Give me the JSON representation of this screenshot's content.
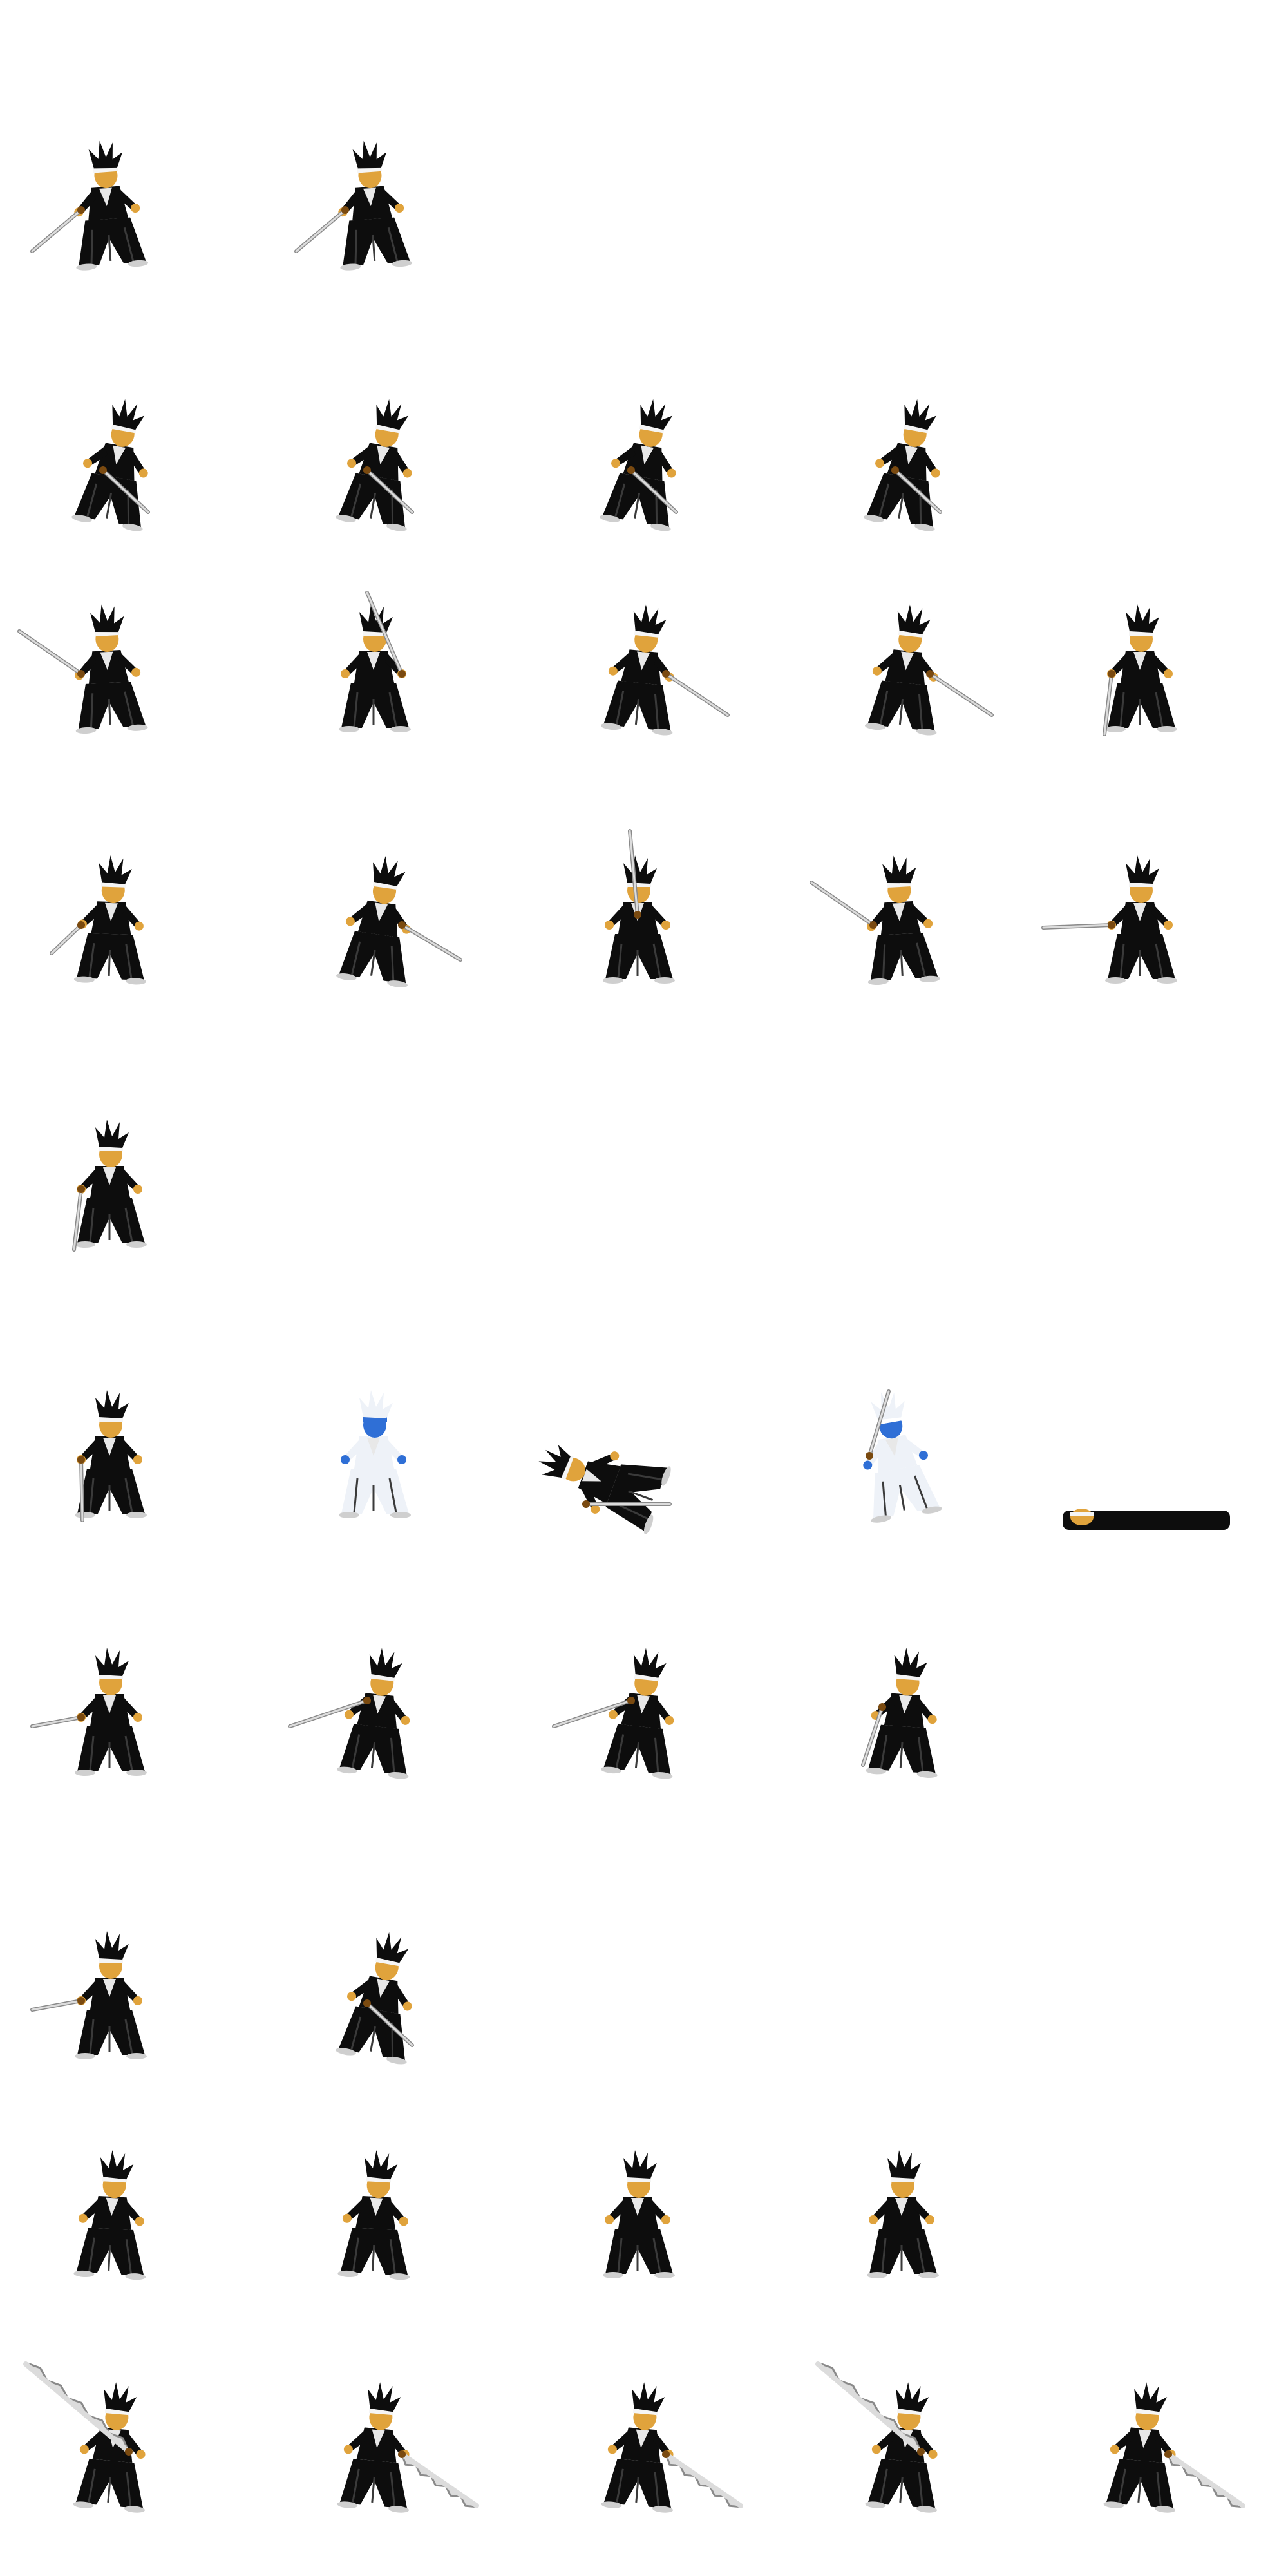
{
  "sheet": {
    "background": "#ffffff",
    "palette": {
      "robe": "#0d0d0d",
      "robe_fold": "#3a3a3a",
      "skin": "#e0a33c",
      "skin_shade": "#a8701e",
      "headband": "#f5f5f5",
      "blade": "#dcdcdc",
      "blade_edge": "#8a8a8a",
      "hilt": "#7a4a10",
      "spirit_white": "#eef2f8",
      "spirit_blue": "#2f6fd6"
    },
    "rows": [
      {
        "frames": [
          {
            "pose": "stance-sword-low"
          },
          {
            "pose": "stance-sword-low"
          }
        ]
      },
      {
        "frames": [
          {
            "pose": "dash-forward"
          },
          {
            "pose": "dash-forward"
          },
          {
            "pose": "dash-forward"
          },
          {
            "pose": "dash-forward"
          }
        ]
      },
      {
        "frames": [
          {
            "pose": "sword-raised-back"
          },
          {
            "pose": "sword-overhead"
          },
          {
            "pose": "slash-low-forward"
          },
          {
            "pose": "slash-low-forward"
          },
          {
            "pose": "guard-sword-down"
          }
        ]
      },
      {
        "frames": [
          {
            "pose": "crouch-ready"
          },
          {
            "pose": "thrust-forward"
          },
          {
            "pose": "sword-up-vertical"
          },
          {
            "pose": "sword-raised-back"
          },
          {
            "pose": "sword-horizontal-back"
          }
        ]
      },
      {
        "frames": [
          {
            "pose": "guard-sword-down"
          }
        ]
      },
      {
        "frames": [
          {
            "pose": "stand-tall"
          },
          {
            "pose": "hit-flash"
          },
          {
            "pose": "fall-back"
          },
          {
            "pose": "hit-flash-fade"
          },
          {
            "pose": "knocked-down"
          }
        ]
      },
      {
        "frames": [
          {
            "pose": "stance-sword-mid"
          },
          {
            "pose": "jump-sword-back"
          },
          {
            "pose": "jump-sword-back"
          },
          {
            "pose": "jump-sword-down"
          }
        ]
      },
      {
        "frames": [
          {
            "pose": "stance-sword-mid"
          },
          {
            "pose": "dash-forward"
          }
        ]
      },
      {
        "frames": [
          {
            "pose": "walk-open-hands"
          },
          {
            "pose": "walk-open-hands"
          },
          {
            "pose": "stand-idle"
          },
          {
            "pose": "stand-idle"
          }
        ]
      },
      {
        "frames": [
          {
            "pose": "serrated-blade-raised"
          },
          {
            "pose": "serrated-blade-sweep"
          },
          {
            "pose": "serrated-blade-sweep"
          },
          {
            "pose": "serrated-blade-raised"
          },
          {
            "pose": "serrated-blade-sweep"
          }
        ]
      }
    ]
  }
}
